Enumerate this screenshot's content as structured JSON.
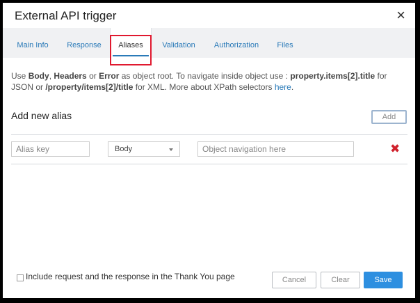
{
  "dialog": {
    "title": "External API trigger",
    "close_icon": "×"
  },
  "tabs": [
    {
      "label": "Main Info",
      "active": false
    },
    {
      "label": "Response",
      "active": false
    },
    {
      "label": "Aliases",
      "active": true
    },
    {
      "label": "Validation",
      "active": false
    },
    {
      "label": "Authorization",
      "active": false
    },
    {
      "label": "Files",
      "active": false
    }
  ],
  "description": {
    "use": "Use ",
    "body": "Body",
    "comma": ", ",
    "headers": "Headers",
    "or": " or ",
    "error": "Error",
    "text1": " as object root. To navigate inside object use : ",
    "json_example": "property.items[2].title",
    "for_json": " for JSON or ",
    "xml_example": "/property/items[2]/title",
    "for_xml": " for XML. More about XPath selectors ",
    "link": "here",
    "end": "."
  },
  "add_alias": {
    "title": "Add new alias",
    "add_button": "Add"
  },
  "alias_row": {
    "key_placeholder": "Alias key",
    "root_select": "Body",
    "nav_placeholder": "Object navigation here",
    "delete_icon": "✖"
  },
  "footer": {
    "checkbox_label": "Include request and the response in the Thank You page",
    "cancel": "Cancel",
    "clear": "Clear",
    "save": "Save"
  },
  "colors": {
    "accent": "#2d8fe0",
    "tab_link": "#2a7ab8",
    "highlight": "#e0192f",
    "delete": "#d0212c"
  }
}
